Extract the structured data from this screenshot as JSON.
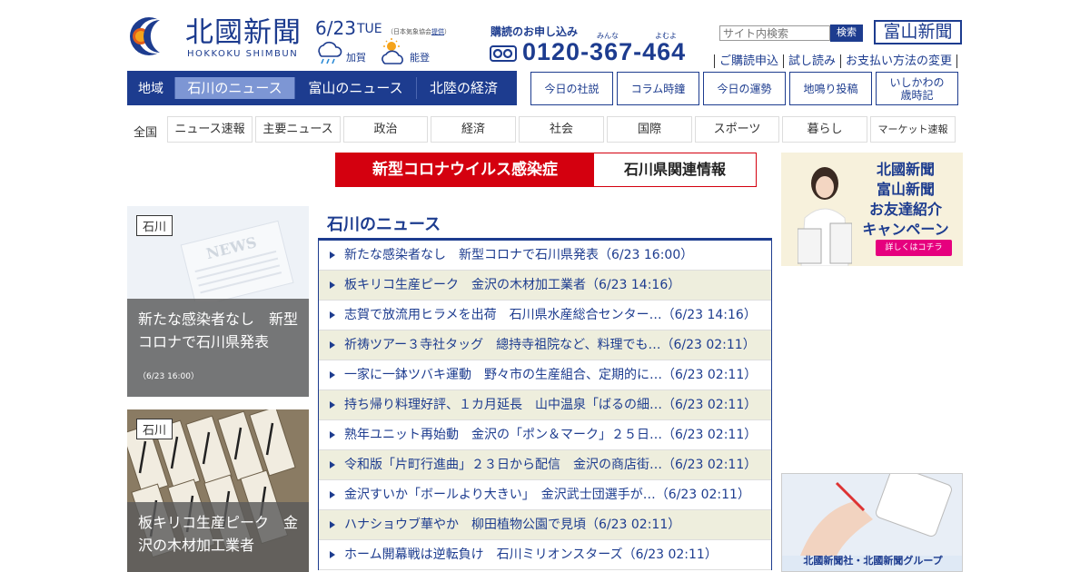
{
  "header": {
    "logo_title": "北國新聞",
    "logo_roman": "HOKKOKU SHIMBUN",
    "date": "6/23",
    "day": "TUE",
    "date_source_prefix": "（日本気象協会",
    "date_source_link": "提供",
    "date_source_suffix": "）",
    "weather": [
      {
        "icon": "cloud-rain-icon",
        "label": "加賀"
      },
      {
        "icon": "sun-cloud-icon",
        "label": "能登"
      }
    ],
    "subscribe_title": "購読のお申し込み",
    "tel_ruby": [
      "みんな",
      "よむよ"
    ],
    "tel": "0120-367-464",
    "search_placeholder": "サイト内検索",
    "search_button": "検索",
    "toyama_logo": "富山新聞",
    "links": [
      "ご購読申込",
      "試し読み",
      "お支払い方法の変更"
    ]
  },
  "region_nav": {
    "label": "地域",
    "tabs": [
      "石川のニュース",
      "富山のニュース",
      "北陸の経済"
    ]
  },
  "box_buttons": [
    {
      "line1": "今日の社説",
      "line2": ""
    },
    {
      "line1": "コラム時鐘",
      "line2": ""
    },
    {
      "line1": "今日の運勢",
      "line2": ""
    },
    {
      "line1": "地鳴り投稿",
      "line2": ""
    },
    {
      "line1": "いしかわの",
      "line2": "歳時記"
    }
  ],
  "genre_nav": {
    "label": "全国",
    "items": [
      "ニュース速報",
      "主要ニュース",
      "政治",
      "経済",
      "社会",
      "国際",
      "スポーツ",
      "暮らし",
      "マーケット速報"
    ]
  },
  "banner": {
    "left": "新型コロナウイルス感染症",
    "right": "石川県関連情報"
  },
  "cards": [
    {
      "tag": "石川",
      "title": "新たな感染者なし　新型コロナで石川県発表",
      "time": "（6/23 16:00）"
    },
    {
      "tag": "石川",
      "title": "板キリコ生産ピーク　金沢の木材加工業者",
      "time": ""
    }
  ],
  "news": {
    "heading": "石川のニュース",
    "items": [
      "新たな感染者なし　新型コロナで石川県発表（6/23 16:00）",
      "板キリコ生産ピーク　金沢の木材加工業者（6/23 14:16）",
      "志賀で放流用ヒラメを出荷　石川県水産総合センター…（6/23 14:16）",
      "祈祷ツアー３寺社タッグ　總持寺祖院など、料理でも…（6/23 02:11）",
      "一家に一鉢ツバキ運動　野々市の生産組合、定期的に…（6/23 02:11）",
      "持ち帰り料理好評、１カ月延長　山中温泉「ばるの細…（6/23 02:11）",
      "熟年ユニット再始動　金沢の「ポン＆マーク」２５日…（6/23 02:11）",
      "令和版「片町行進曲」２３日から配信　金沢の商店街…（6/23 02:11）",
      "金沢すいか「ボールより大きい」　金沢武士団選手が…（6/23 02:11）",
      "ハナショウブ華やか　柳田植物公園で見頃（6/23 02:11）",
      "ホーム開幕戦は逆転負け　石川ミリオンスターズ（6/23 02:11）"
    ]
  },
  "ads": {
    "campaign_lines": [
      "北國新聞",
      "富山新聞",
      "お友達紹介",
      "キャンペーン"
    ],
    "campaign_button": "詳しくはコチラ",
    "group_text": "北國新聞社・北國新聞グループ"
  }
}
